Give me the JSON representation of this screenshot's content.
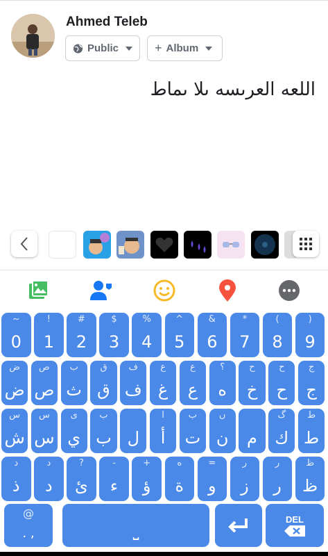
{
  "composer": {
    "user_name": "Ahmed Teleb",
    "audience_label": "Public",
    "album_label": "Album",
    "post_text": "اللعه العرىسه ىلا ىماط"
  },
  "sticker_bar": {
    "back_icon": "chevron-left-icon",
    "grid_icon": "grid-icon",
    "stickers": [
      "blank",
      "memoji-balloon",
      "memoji-graduate",
      "black-heart",
      "purple-drops",
      "sunglasses",
      "vinyl-record",
      "partial"
    ]
  },
  "actions": [
    {
      "name": "photo-icon",
      "color": "#45bd62"
    },
    {
      "name": "tag-people-icon",
      "color": "#1877f2"
    },
    {
      "name": "emoji-icon",
      "color": "#f7b928"
    },
    {
      "name": "location-icon",
      "color": "#f5533d"
    },
    {
      "name": "more-icon",
      "color": "#65676b"
    }
  ],
  "keyboard": {
    "row1": [
      {
        "main": "0",
        "alt": "~"
      },
      {
        "main": "1",
        "alt": "!"
      },
      {
        "main": "2",
        "alt": "#"
      },
      {
        "main": "3",
        "alt": "$"
      },
      {
        "main": "4",
        "alt": "%"
      },
      {
        "main": "5",
        "alt": "^"
      },
      {
        "main": "6",
        "alt": "&"
      },
      {
        "main": "7",
        "alt": "*"
      },
      {
        "main": "8",
        "alt": "("
      },
      {
        "main": "9",
        "alt": ")"
      }
    ],
    "row2": [
      {
        "main": "ض",
        "alt": "ض"
      },
      {
        "main": "ص",
        "alt": "ص"
      },
      {
        "main": "ث",
        "alt": "ب"
      },
      {
        "main": "ق",
        "alt": "ق"
      },
      {
        "main": "ف",
        "alt": "ف"
      },
      {
        "main": "غ",
        "alt": "ع"
      },
      {
        "main": "ع",
        "alt": "ع"
      },
      {
        "main": "ه",
        "alt": "؟"
      },
      {
        "main": "خ",
        "alt": "ح"
      },
      {
        "main": "ح",
        "alt": "ح"
      },
      {
        "main": "ج",
        "alt": "ج"
      }
    ],
    "row3": [
      {
        "main": "ش",
        "alt": "س"
      },
      {
        "main": "س",
        "alt": "س"
      },
      {
        "main": "ي",
        "alt": "ى"
      },
      {
        "main": "ب",
        "alt": "ب"
      },
      {
        "main": "ل",
        "alt": ""
      },
      {
        "main": "أ",
        "alt": "ا"
      },
      {
        "main": "ت",
        "alt": "ب"
      },
      {
        "main": "ن",
        "alt": "ں"
      },
      {
        "main": "م",
        "alt": ""
      },
      {
        "main": "ك",
        "alt": "گ"
      },
      {
        "main": "ط",
        "alt": "ط"
      }
    ],
    "row4": [
      {
        "main": "ذ",
        "alt": "د"
      },
      {
        "main": "د",
        "alt": "د"
      },
      {
        "main": "ئ",
        "alt": "?"
      },
      {
        "main": "ء",
        "alt": "-"
      },
      {
        "main": "ؤ",
        "alt": "+"
      },
      {
        "main": "ة",
        "alt": "ه"
      },
      {
        "main": "و",
        "alt": "="
      },
      {
        "main": "ز",
        "alt": "ر"
      },
      {
        "main": "ر",
        "alt": "ر"
      },
      {
        "main": "ظ",
        "alt": "ظ"
      }
    ],
    "row5": {
      "punct_main": ". ,",
      "punct_alt": "@",
      "space_label": "⎵",
      "enter_icon": "enter-icon",
      "del_label": "DEL"
    }
  }
}
